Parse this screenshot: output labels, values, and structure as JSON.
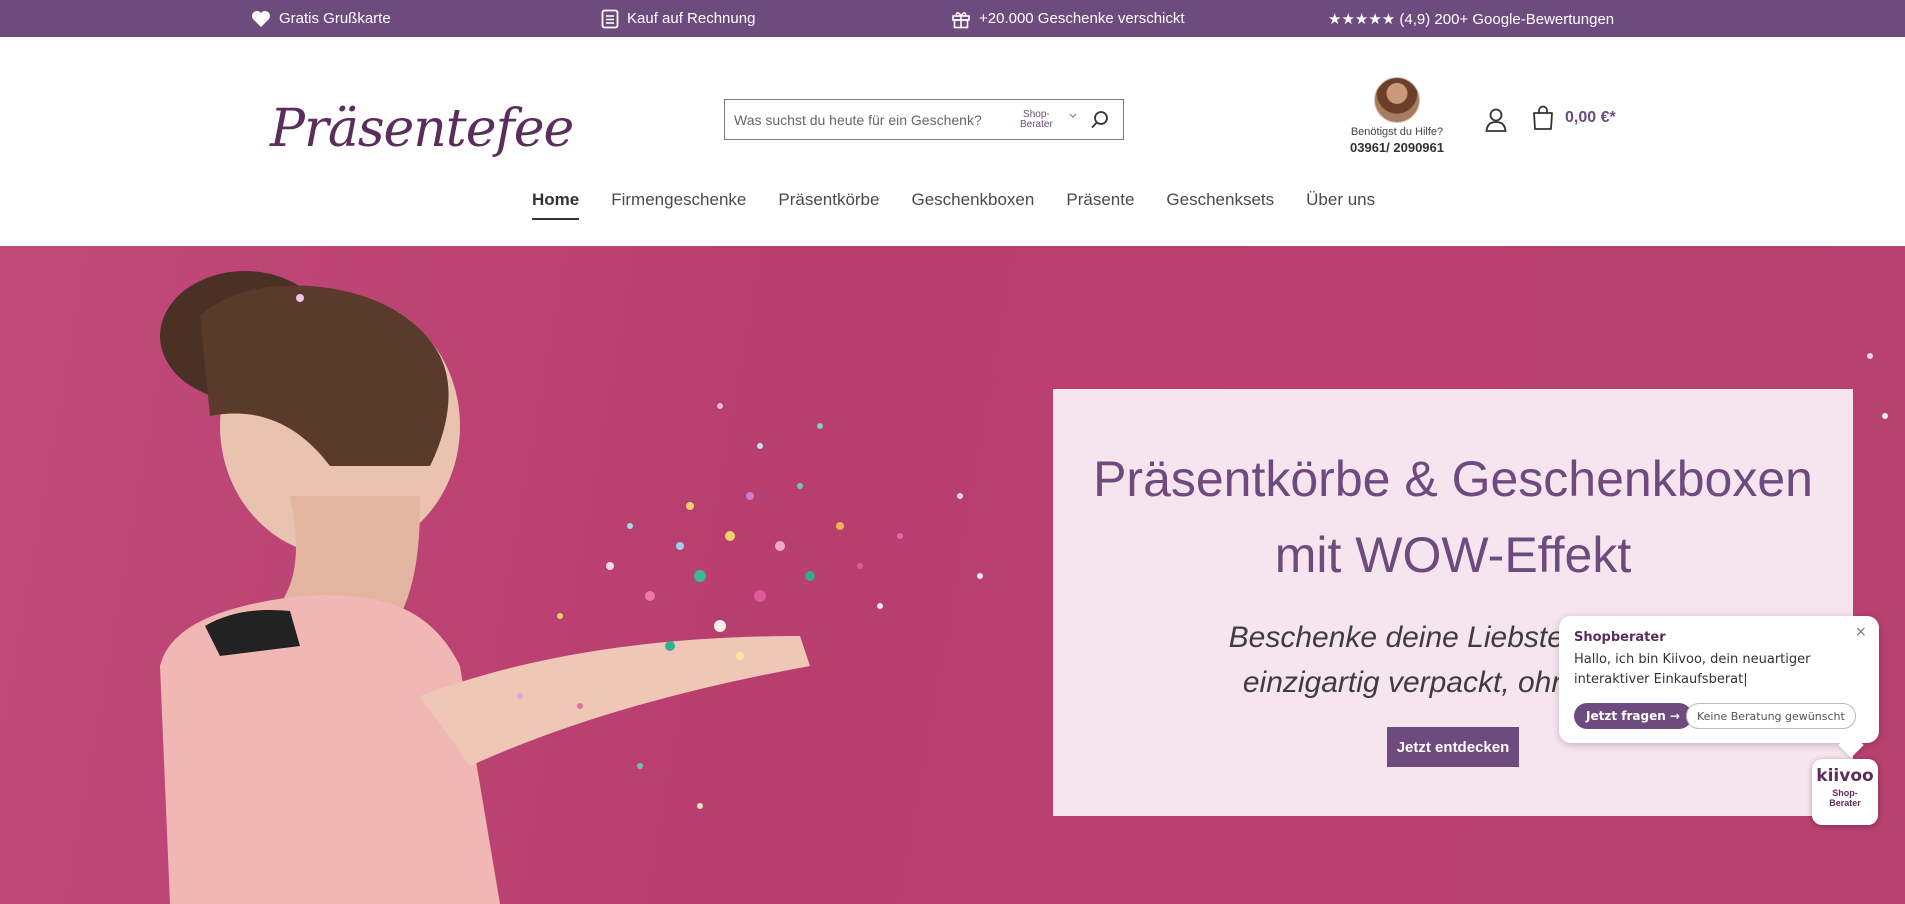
{
  "colors": {
    "brand_purple": "#6e4b7e",
    "hero_pink": "#b9406f",
    "hero_box": "#f6e4ee"
  },
  "topbar": {
    "items": [
      {
        "icon": "heart-icon",
        "label": "Gratis Grußkarte"
      },
      {
        "icon": "invoice-icon",
        "label": "Kauf auf Rechnung"
      },
      {
        "icon": "gift-icon",
        "label": "+20.000 Geschenke verschickt"
      },
      {
        "icon": "",
        "label": "★★★★★ (4,9) 200+ Google-Bewertungen"
      }
    ]
  },
  "header": {
    "logo_text": "Präsentefee",
    "search": {
      "placeholder": "Was suchst du heute für ein Geschenk?",
      "shop_berater_line1": "Shop-",
      "shop_berater_line2": "Berater"
    },
    "help": {
      "label": "Benötigst du Hilfe?",
      "phone": "03961/ 2090961"
    },
    "cart_total": "0,00 €*"
  },
  "nav": {
    "items": [
      {
        "label": "Home",
        "active": true
      },
      {
        "label": "Firmengeschenke"
      },
      {
        "label": "Präsentkörbe"
      },
      {
        "label": "Geschenkboxen"
      },
      {
        "label": "Präsente"
      },
      {
        "label": "Geschenksets"
      },
      {
        "label": "Über uns"
      }
    ]
  },
  "hero": {
    "title_line1": "Präsentkörbe & Geschenkboxen",
    "title_line2": "mit WOW-Effekt",
    "subtitle_line1": "Beschenke deine Liebsten, Mitarbe",
    "subtitle_line2": "einzigartig verpackt, ohne stunde",
    "cta": "Jetzt entdecken"
  },
  "chat": {
    "title": "Shopberater",
    "close": "×",
    "message": "Hallo, ich bin Kiivoo, dein neuartiger interaktiver Einkaufsberat|",
    "ask_button": "Jetzt fragen →",
    "decline_button": "Keine Beratung gewünscht"
  },
  "kiivoo_widget": {
    "logo": "kiivoo",
    "label_line1": "Shop-",
    "label_line2": "Berater"
  }
}
